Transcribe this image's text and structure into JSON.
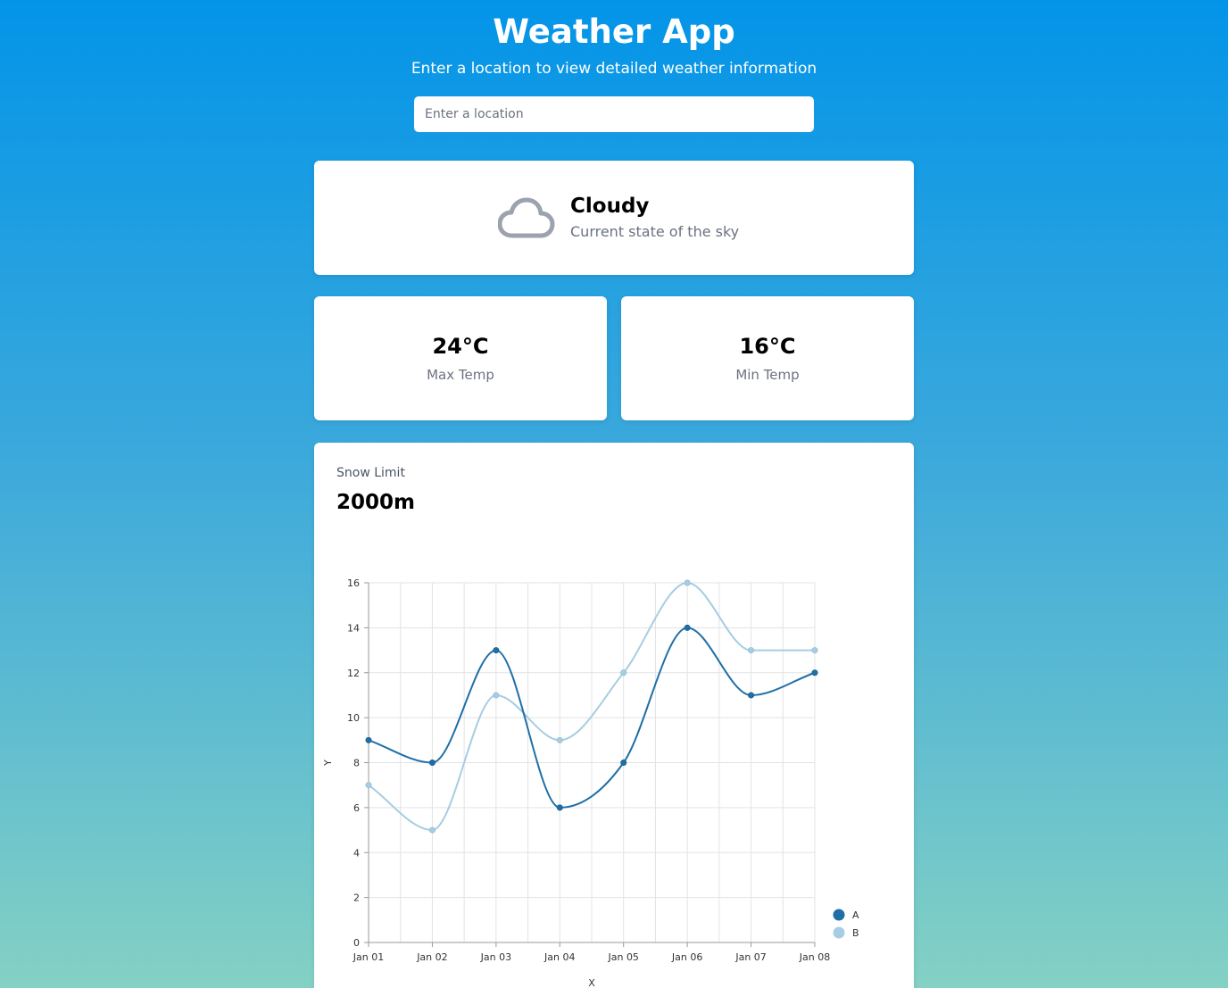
{
  "header": {
    "title": "Weather App",
    "subtitle": "Enter a location to view detailed weather information"
  },
  "search": {
    "placeholder": "Enter a location",
    "value": ""
  },
  "sky": {
    "icon": "cloud-icon",
    "condition": "Cloudy",
    "description": "Current state of the sky"
  },
  "temps": {
    "max": {
      "value": "24°C",
      "label": "Max Temp"
    },
    "min": {
      "value": "16°C",
      "label": "Min Temp"
    }
  },
  "snow": {
    "label": "Snow Limit",
    "value": "2000m"
  },
  "colors": {
    "series_a": "#1f6fa6",
    "series_b": "#a6cde2",
    "grid": "#e3e3e3",
    "axis": "#999999"
  },
  "chart_data": {
    "type": "line",
    "x": [
      "Jan 01",
      "Jan 02",
      "Jan 03",
      "Jan 04",
      "Jan 05",
      "Jan 06",
      "Jan 07",
      "Jan 08"
    ],
    "series": [
      {
        "name": "A",
        "values": [
          9,
          8,
          13,
          6,
          8,
          14,
          11,
          12
        ]
      },
      {
        "name": "B",
        "values": [
          7,
          5,
          11,
          9,
          12,
          16,
          13,
          13
        ]
      }
    ],
    "xlabel": "X",
    "ylabel": "Y",
    "ylim": [
      0,
      16
    ],
    "yticks": [
      0,
      2,
      4,
      6,
      8,
      10,
      12,
      14,
      16
    ],
    "grid": true,
    "legend": "bottom-right",
    "curve": "smooth"
  }
}
